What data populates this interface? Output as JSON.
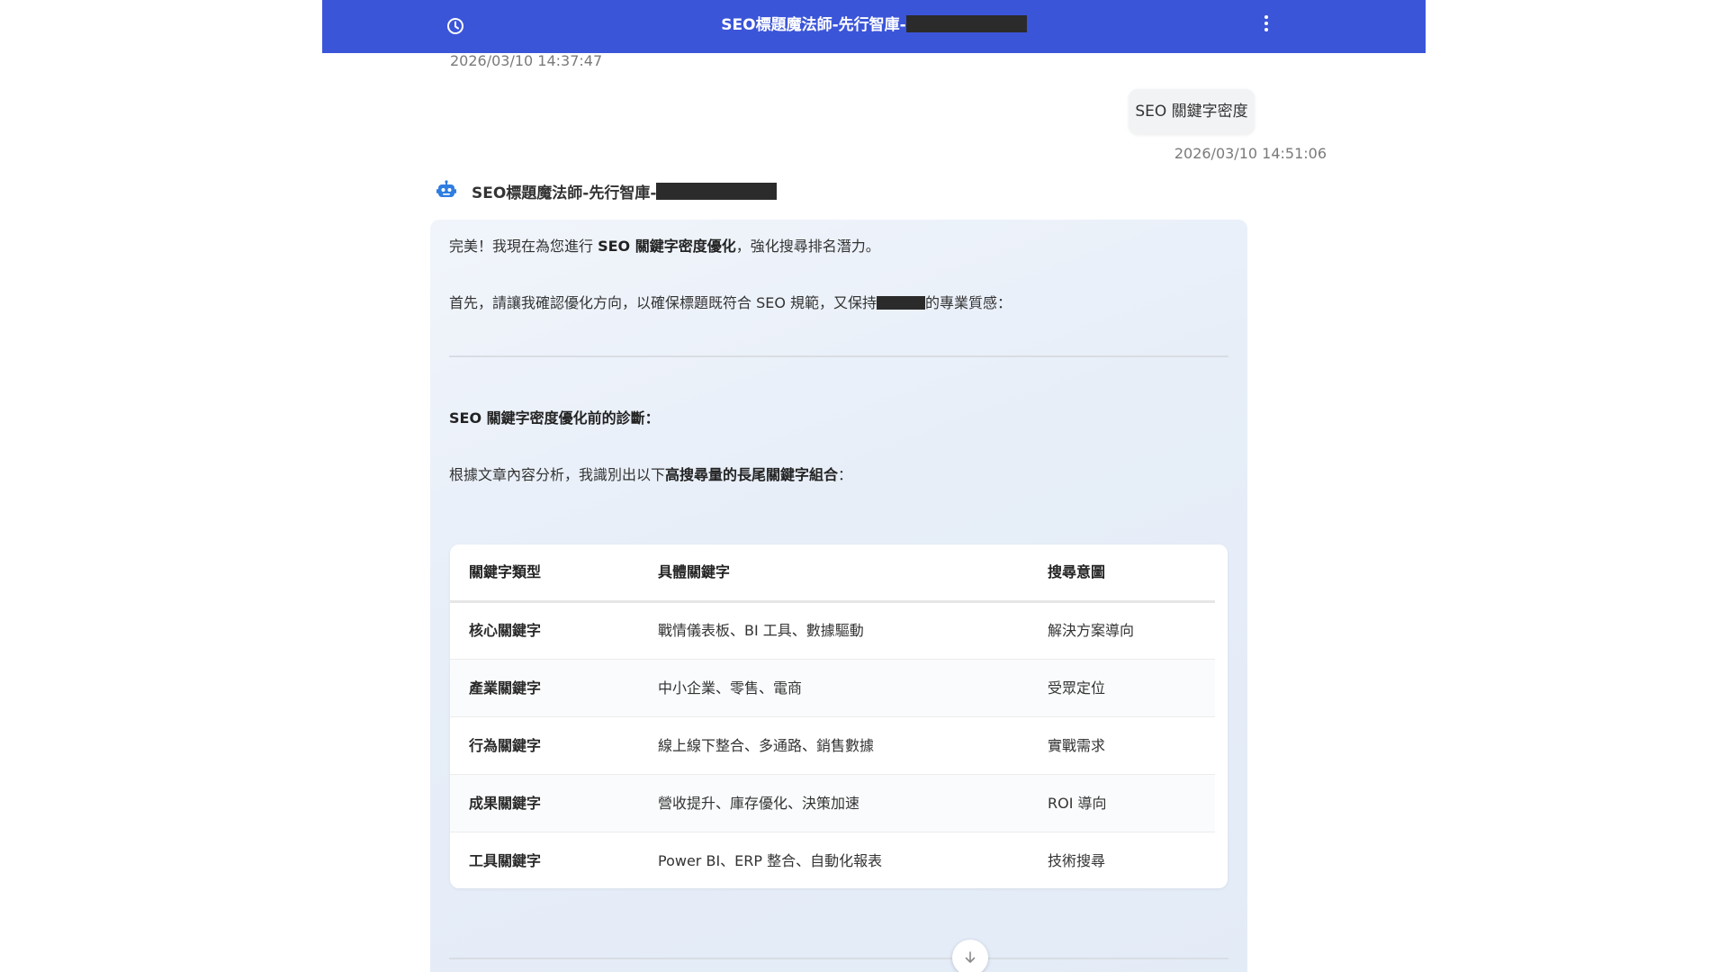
{
  "header": {
    "title": "SEO標題魔法師-先行智庫-"
  },
  "chat": {
    "prev_timestamp": "2026/03/10 14:37:47",
    "user_message": "SEO 關鍵字密度",
    "user_timestamp": "2026/03/10 14:51:06",
    "bot_name": "SEO標題魔法師-先行智庫-",
    "reply": {
      "p1_pre": "完美！我現在為您進行 ",
      "p1_bold": "SEO 關鍵字密度優化",
      "p1_post": "，強化搜尋排名潛力。",
      "p2_pre": "首先，請讓我確認優化方向，以確保標題既符合 SEO 規範，又保持",
      "p2_post": "的專業質感：",
      "diagnosis_heading": "SEO 關鍵字密度優化前的診斷：",
      "p4_pre": "根據文章內容分析，我識別出以下",
      "p4_bold": "高搜尋量的長尾關鍵字組合",
      "p4_post": "："
    }
  },
  "table": {
    "headers": [
      "關鍵字類型",
      "具體關鍵字",
      "搜尋意圖"
    ],
    "rows": [
      [
        "核心關鍵字",
        "戰情儀表板、BI 工具、數據驅動",
        "解決方案導向"
      ],
      [
        "產業關鍵字",
        "中小企業、零售、電商",
        "受眾定位"
      ],
      [
        "行為關鍵字",
        "線上線下整合、多通路、銷售數據",
        "實戰需求"
      ],
      [
        "成果關鍵字",
        "營收提升、庫存優化、決策加速",
        "ROI 導向"
      ],
      [
        "工具關鍵字",
        "Power BI、ERP 整合、自動化報表",
        "技術搜尋"
      ]
    ]
  },
  "icons": {
    "history": "clock-icon",
    "menu": "more-vertical-icon",
    "bot_avatar": "robot-icon",
    "scroll": "arrow-down-icon"
  },
  "colors": {
    "header_bg": "#3b55d9",
    "bot_bubble": "#e7eef8",
    "user_bubble": "#f2f3f5",
    "bot_icon": "#2f7de1"
  }
}
